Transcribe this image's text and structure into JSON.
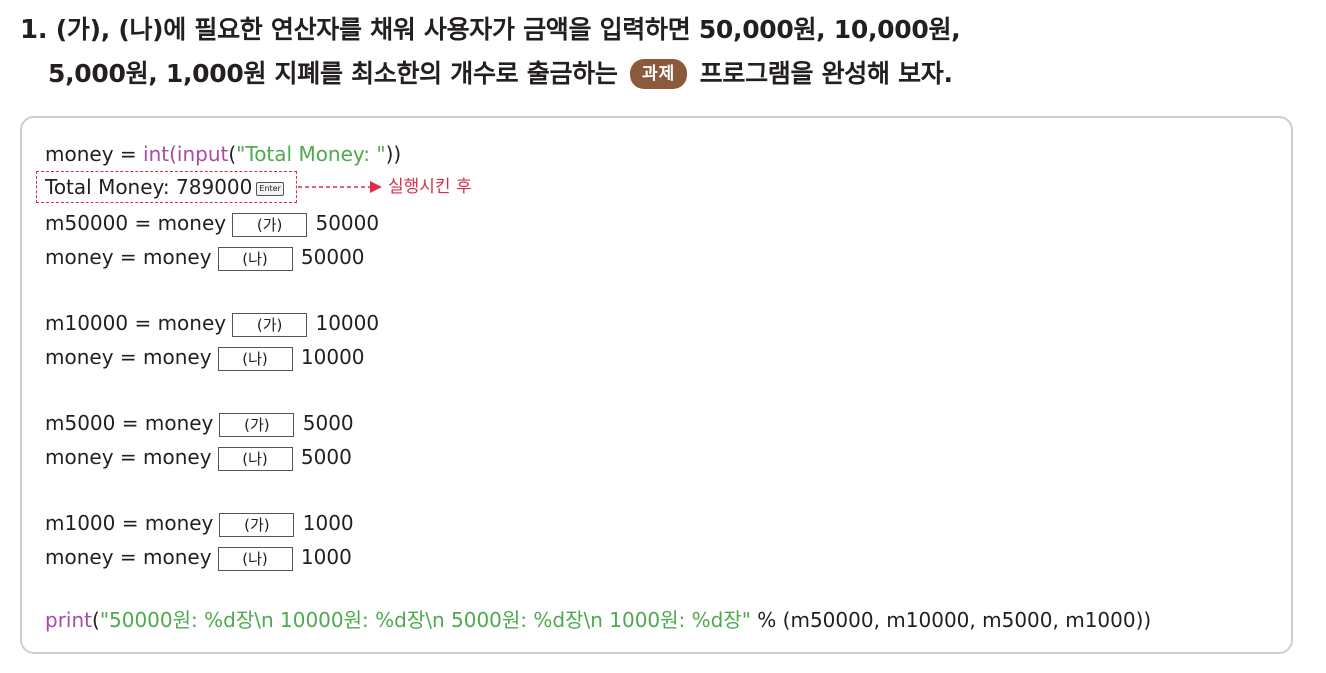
{
  "question": {
    "number": "1.",
    "line1": "(가), (나)에 필요한 연산자를 채워 사용자가 금액을 입력하면 50,000원, 10,000원,",
    "line2_before": "5,000원, 1,000원 지폐를 최소한의 개수로 출금하는",
    "badge": "과제",
    "line2_after": "프로그램을 완성해 보자."
  },
  "code": {
    "line1": {
      "var": "money = ",
      "fn1": "int",
      "p1": "(",
      "fn2": "input",
      "p2": "(",
      "str": "\"Total Money: \"",
      "end": "))"
    },
    "input_text": "Total Money: 789000",
    "enter_key": "Enter",
    "note": "실행시킨 후",
    "blank_a": "(가)",
    "blank_b": "(나)",
    "rows": [
      {
        "lhs": "m50000 = money",
        "rhs": "50000"
      },
      {
        "lhs": "money = money",
        "rhs": "50000"
      },
      {
        "lhs": "m10000 = money",
        "rhs": "10000"
      },
      {
        "lhs": "money = money",
        "rhs": "10000"
      },
      {
        "lhs": "m5000 = money",
        "rhs": "5000"
      },
      {
        "lhs": "money = money",
        "rhs": "5000"
      },
      {
        "lhs": "m1000 = money",
        "rhs": "1000"
      },
      {
        "lhs": "money = money",
        "rhs": "1000"
      }
    ],
    "print": {
      "fn": "print",
      "open": "(",
      "str": "\"50000원: %d장\\n 10000원: %d장\\n 5000원: %d장\\n 1000원: %d장\"",
      "rest": " % (m50000, m10000, m5000, m1000))"
    }
  },
  "colors": {
    "keyword": "#a64ca6",
    "string": "#4daa4d",
    "note": "#d7304a",
    "badge": "#8b5a3c"
  }
}
